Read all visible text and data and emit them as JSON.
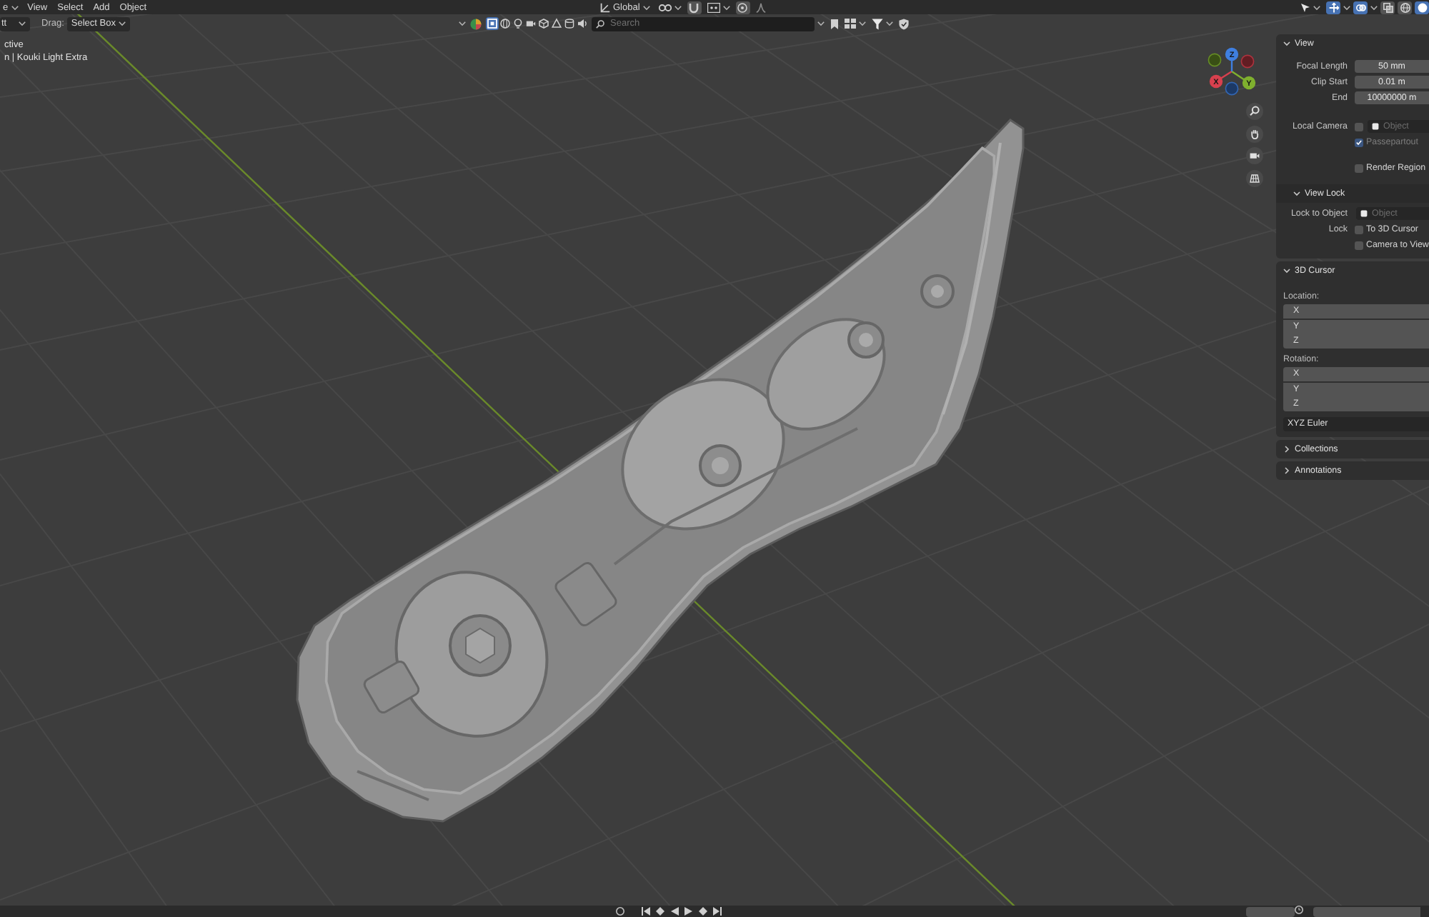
{
  "header": {
    "mode_menu": {
      "label": "e"
    },
    "menus": [
      {
        "label": "View"
      },
      {
        "label": "Select"
      },
      {
        "label": "Add"
      },
      {
        "label": "Object"
      }
    ],
    "transform_orientation": {
      "label": "Global"
    },
    "snap": {
      "on": false
    },
    "proportional_edit": {
      "on": false
    },
    "viewport_toggles": [
      {
        "kind": "gizmo",
        "on": true
      },
      {
        "kind": "overlay",
        "on": true
      },
      {
        "kind": "xray",
        "on": false
      }
    ],
    "shading_modes": [
      {
        "kind": "wireframe",
        "selected": false
      },
      {
        "kind": "solid",
        "selected": true
      }
    ]
  },
  "tool_settings": {
    "tool_menu": {
      "label": "tt"
    },
    "drag_label": "Drag:",
    "drag_menu": {
      "label": "Select Box"
    }
  },
  "viewport_header": {
    "filter_toggles": [
      {
        "on": true
      },
      {
        "on": false
      },
      {
        "on": false
      },
      {
        "on": false
      },
      {
        "on": false
      },
      {
        "on": false
      },
      {
        "on": false
      },
      {
        "on": false
      }
    ],
    "search": {
      "placeholder": "Search"
    }
  },
  "viewport": {
    "overlay_text": [
      "ctive",
      "n | Kouki Light Extra"
    ],
    "navigation_gizmo": {
      "axes": [
        {
          "label": "X",
          "color": "#d8404e"
        },
        {
          "label": "Y",
          "color": "#7fb02e"
        },
        {
          "label": "Z",
          "color": "#3f7fe0"
        }
      ]
    }
  },
  "sidebar": {
    "panels": [
      {
        "title": "View",
        "expanded": true,
        "rows": [
          {
            "kind": "number",
            "label": "Focal Length",
            "value": "50 mm"
          },
          {
            "kind": "number",
            "label": "Clip Start",
            "value": "0.01 m"
          },
          {
            "kind": "number",
            "label": "End",
            "value": "10000000 m"
          },
          {
            "kind": "object",
            "label": "Local Camera",
            "checked": false,
            "placeholder": "Object"
          },
          {
            "kind": "checkbox",
            "text": "Passepartout",
            "checked": true,
            "disabled": true
          },
          {
            "kind": "checkbox",
            "text": "Render Region",
            "checked": false,
            "disabled": false
          }
        ],
        "subpanels": [
          {
            "title": "View Lock",
            "expanded": true,
            "rows": [
              {
                "kind": "object",
                "label": "Lock to Object",
                "placeholder": "Object"
              },
              {
                "kind": "checkbox",
                "label": "Lock",
                "text": "To 3D Cursor",
                "checked": false,
                "disabled": false
              },
              {
                "kind": "checkbox",
                "text": "Camera to View",
                "checked": false,
                "disabled": false
              }
            ]
          }
        ]
      },
      {
        "title": "3D Cursor",
        "expanded": true,
        "rows": [
          {
            "kind": "heading",
            "label": "Location:"
          },
          {
            "kind": "vector",
            "axes": [
              "X",
              "Y",
              "Z"
            ]
          },
          {
            "kind": "heading",
            "label": "Rotation:"
          },
          {
            "kind": "vector",
            "axes": [
              "X",
              "Y",
              "Z"
            ]
          },
          {
            "kind": "dropdown",
            "value": "XYZ Euler"
          }
        ]
      },
      {
        "title": "Collections",
        "expanded": false
      },
      {
        "title": "Annotations",
        "expanded": false
      }
    ]
  }
}
